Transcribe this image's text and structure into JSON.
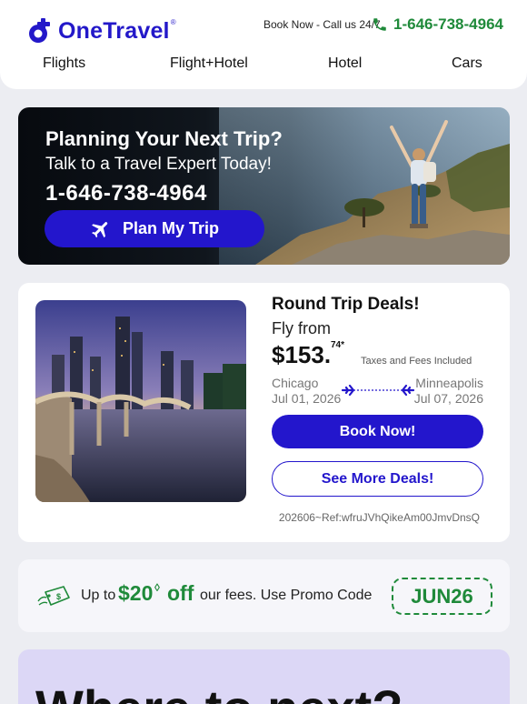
{
  "brand": {
    "name": "OneTravel",
    "reg_mark": "®",
    "color": "#2318c9"
  },
  "header": {
    "book_now": "Book Now - Call us 24/7",
    "phone": "1-646-738-4964",
    "phone_icon": "phone-icon",
    "nav": [
      "Flights",
      "Flight+Hotel",
      "Hotel",
      "Cars"
    ]
  },
  "banner": {
    "title": "Planning Your Next Trip?",
    "subtitle": "Talk to a Travel Expert Today!",
    "phone": "1-646-738-4964",
    "button": "Plan My Trip",
    "button_icon": "airplane-icon"
  },
  "deal": {
    "title": "Round Trip Deals!",
    "fly_from": "Fly from",
    "price": "$153.",
    "price_cents": "74*",
    "taxes": "Taxes and Fees Included",
    "from_city": "Chicago",
    "from_date": "Jul 01, 2026",
    "to_city": "Minneapolis",
    "to_date": "Jul 07, 2026",
    "book_button": "Book Now!",
    "more_button": "See More Deals!",
    "ref": "202606~Ref:wfruJVhQikeAm00JmvDnsQ"
  },
  "promo": {
    "pre": "Up to",
    "amount": "$20",
    "amount_mark": "◊",
    "off": "off",
    "post": "our fees. Use Promo Code",
    "code": "JUN26",
    "icon": "price-tag-icon"
  },
  "next": {
    "title": "Where to next?"
  },
  "colors": {
    "accent": "#2316cc",
    "green": "#1f8a3a",
    "lavender": "#dcd7f6"
  }
}
